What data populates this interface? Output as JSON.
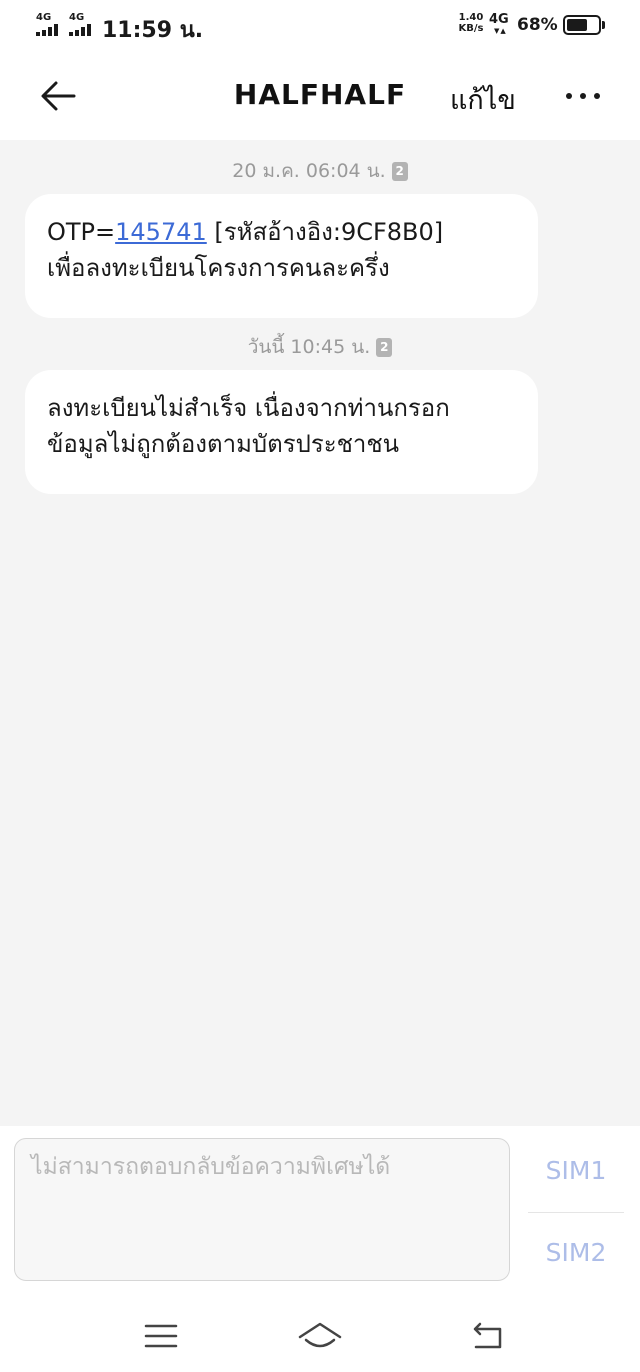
{
  "status_bar": {
    "sim1_network": "4G",
    "sim2_network": "4G",
    "time": "11:59 น.",
    "speed_value": "1.40",
    "speed_unit": "KB/s",
    "data_network": "4G",
    "battery_percent": "68%",
    "battery_level": 0.68
  },
  "header": {
    "back_icon": "arrow-left-icon",
    "title": "HALFHALF",
    "edit_label": "แก้ไข",
    "more_icon": "more-dots-icon"
  },
  "messages": [
    {
      "timestamp": "20 ม.ค. 06:04 น.",
      "sim": "2",
      "line1_prefix": "OTP=",
      "otp_code": "145741",
      "line1_suffix": " [รหัสอ้างอิง:9CF8B0]",
      "line2": "เพื่อลงทะเบียนโครงการคนละครึ่ง"
    },
    {
      "timestamp": "วันนี้ 10:45 น.",
      "sim": "2",
      "line1": "ลงทะเบียนไม่สำเร็จ เนื่องจากท่านกรอก",
      "line2": "ข้อมูลไม่ถูกต้องตามบัตรประชาชน"
    }
  ],
  "composer": {
    "placeholder": "ไม่สามารถตอบกลับข้อความพิเศษได้",
    "sim1_label": "SIM1",
    "sim2_label": "SIM2"
  },
  "nav_bar": {
    "menu_icon": "menu-lines-icon",
    "home_icon": "home-icon",
    "back_icon": "return-icon"
  },
  "colors": {
    "background": "#f4f4f4",
    "link": "#3c6ad6",
    "sim_button": "#adbde8",
    "timestamp": "#9a9a9a"
  }
}
